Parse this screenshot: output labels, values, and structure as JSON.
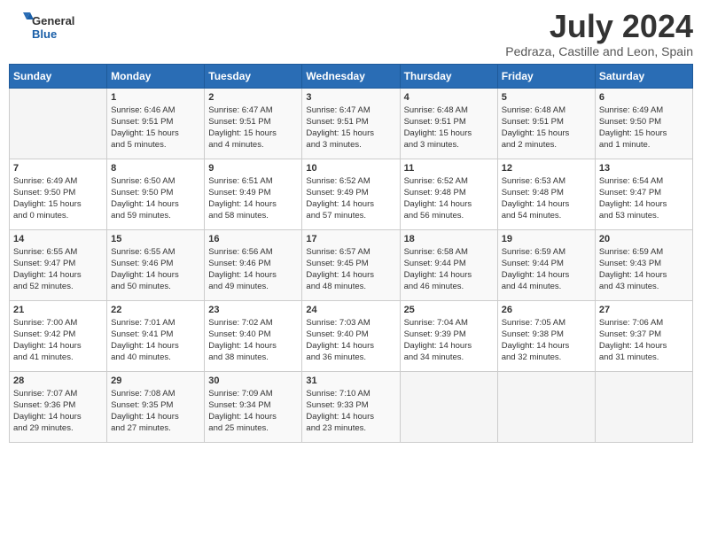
{
  "header": {
    "logo_general": "General",
    "logo_blue": "Blue",
    "month_year": "July 2024",
    "location": "Pedraza, Castille and Leon, Spain"
  },
  "days_of_week": [
    "Sunday",
    "Monday",
    "Tuesday",
    "Wednesday",
    "Thursday",
    "Friday",
    "Saturday"
  ],
  "weeks": [
    [
      {
        "day": "",
        "info": ""
      },
      {
        "day": "1",
        "info": "Sunrise: 6:46 AM\nSunset: 9:51 PM\nDaylight: 15 hours\nand 5 minutes."
      },
      {
        "day": "2",
        "info": "Sunrise: 6:47 AM\nSunset: 9:51 PM\nDaylight: 15 hours\nand 4 minutes."
      },
      {
        "day": "3",
        "info": "Sunrise: 6:47 AM\nSunset: 9:51 PM\nDaylight: 15 hours\nand 3 minutes."
      },
      {
        "day": "4",
        "info": "Sunrise: 6:48 AM\nSunset: 9:51 PM\nDaylight: 15 hours\nand 3 minutes."
      },
      {
        "day": "5",
        "info": "Sunrise: 6:48 AM\nSunset: 9:51 PM\nDaylight: 15 hours\nand 2 minutes."
      },
      {
        "day": "6",
        "info": "Sunrise: 6:49 AM\nSunset: 9:50 PM\nDaylight: 15 hours\nand 1 minute."
      }
    ],
    [
      {
        "day": "7",
        "info": "Sunrise: 6:49 AM\nSunset: 9:50 PM\nDaylight: 15 hours\nand 0 minutes."
      },
      {
        "day": "8",
        "info": "Sunrise: 6:50 AM\nSunset: 9:50 PM\nDaylight: 14 hours\nand 59 minutes."
      },
      {
        "day": "9",
        "info": "Sunrise: 6:51 AM\nSunset: 9:49 PM\nDaylight: 14 hours\nand 58 minutes."
      },
      {
        "day": "10",
        "info": "Sunrise: 6:52 AM\nSunset: 9:49 PM\nDaylight: 14 hours\nand 57 minutes."
      },
      {
        "day": "11",
        "info": "Sunrise: 6:52 AM\nSunset: 9:48 PM\nDaylight: 14 hours\nand 56 minutes."
      },
      {
        "day": "12",
        "info": "Sunrise: 6:53 AM\nSunset: 9:48 PM\nDaylight: 14 hours\nand 54 minutes."
      },
      {
        "day": "13",
        "info": "Sunrise: 6:54 AM\nSunset: 9:47 PM\nDaylight: 14 hours\nand 53 minutes."
      }
    ],
    [
      {
        "day": "14",
        "info": "Sunrise: 6:55 AM\nSunset: 9:47 PM\nDaylight: 14 hours\nand 52 minutes."
      },
      {
        "day": "15",
        "info": "Sunrise: 6:55 AM\nSunset: 9:46 PM\nDaylight: 14 hours\nand 50 minutes."
      },
      {
        "day": "16",
        "info": "Sunrise: 6:56 AM\nSunset: 9:46 PM\nDaylight: 14 hours\nand 49 minutes."
      },
      {
        "day": "17",
        "info": "Sunrise: 6:57 AM\nSunset: 9:45 PM\nDaylight: 14 hours\nand 48 minutes."
      },
      {
        "day": "18",
        "info": "Sunrise: 6:58 AM\nSunset: 9:44 PM\nDaylight: 14 hours\nand 46 minutes."
      },
      {
        "day": "19",
        "info": "Sunrise: 6:59 AM\nSunset: 9:44 PM\nDaylight: 14 hours\nand 44 minutes."
      },
      {
        "day": "20",
        "info": "Sunrise: 6:59 AM\nSunset: 9:43 PM\nDaylight: 14 hours\nand 43 minutes."
      }
    ],
    [
      {
        "day": "21",
        "info": "Sunrise: 7:00 AM\nSunset: 9:42 PM\nDaylight: 14 hours\nand 41 minutes."
      },
      {
        "day": "22",
        "info": "Sunrise: 7:01 AM\nSunset: 9:41 PM\nDaylight: 14 hours\nand 40 minutes."
      },
      {
        "day": "23",
        "info": "Sunrise: 7:02 AM\nSunset: 9:40 PM\nDaylight: 14 hours\nand 38 minutes."
      },
      {
        "day": "24",
        "info": "Sunrise: 7:03 AM\nSunset: 9:40 PM\nDaylight: 14 hours\nand 36 minutes."
      },
      {
        "day": "25",
        "info": "Sunrise: 7:04 AM\nSunset: 9:39 PM\nDaylight: 14 hours\nand 34 minutes."
      },
      {
        "day": "26",
        "info": "Sunrise: 7:05 AM\nSunset: 9:38 PM\nDaylight: 14 hours\nand 32 minutes."
      },
      {
        "day": "27",
        "info": "Sunrise: 7:06 AM\nSunset: 9:37 PM\nDaylight: 14 hours\nand 31 minutes."
      }
    ],
    [
      {
        "day": "28",
        "info": "Sunrise: 7:07 AM\nSunset: 9:36 PM\nDaylight: 14 hours\nand 29 minutes."
      },
      {
        "day": "29",
        "info": "Sunrise: 7:08 AM\nSunset: 9:35 PM\nDaylight: 14 hours\nand 27 minutes."
      },
      {
        "day": "30",
        "info": "Sunrise: 7:09 AM\nSunset: 9:34 PM\nDaylight: 14 hours\nand 25 minutes."
      },
      {
        "day": "31",
        "info": "Sunrise: 7:10 AM\nSunset: 9:33 PM\nDaylight: 14 hours\nand 23 minutes."
      },
      {
        "day": "",
        "info": ""
      },
      {
        "day": "",
        "info": ""
      },
      {
        "day": "",
        "info": ""
      }
    ]
  ]
}
